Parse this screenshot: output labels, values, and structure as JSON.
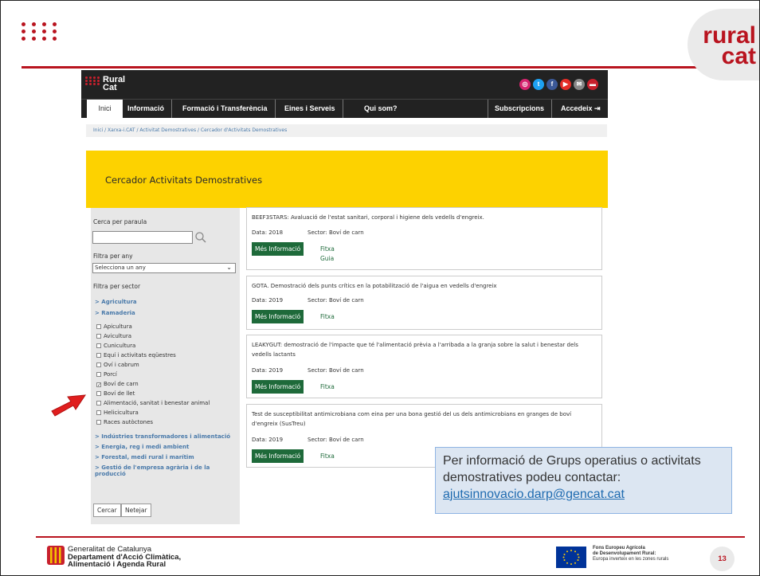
{
  "slide": {
    "logo_top_right": {
      "line1": "rural",
      "line2": "cat"
    },
    "tooltip": {
      "text": "Per informació de Grups operatius o activitats demostratives podeu contactar:",
      "email": "ajutsinnovacio.darp@gencat.cat"
    },
    "footer": {
      "gen_line1": "Generalitat de Catalunya",
      "gen_line2": "Departament d'Acció Climàtica,",
      "gen_line3": "Alimentació i Agenda Rural",
      "eu_line1": "Fons Europeu Agrícola",
      "eu_line2": "de Desenvolupament Rural:",
      "eu_line3": "Europa inverteix en les zones rurals",
      "page_number": "13"
    },
    "colors": {
      "brand_red": "#b9141f",
      "banner_yellow": "#fdd200",
      "button_green": "#1e6a3a",
      "tooltip_bg": "#dce6f2"
    },
    "arrow_icon": "red-arrow-icon"
  },
  "site": {
    "logo": {
      "line1": "Rural",
      "line2": "Cat"
    },
    "social_icons": [
      "instagram-icon",
      "twitter-icon",
      "facebook-icon",
      "youtube-icon",
      "mail-icon",
      "rss-icon"
    ],
    "nav": {
      "inici": "Inici",
      "informacio": "Informació",
      "formacio": "Formació i Transferència",
      "eines": "Eines i Serveis",
      "qui": "Qui som?",
      "subscripcions": "Subscripcions",
      "accedeix": "Accedeix"
    },
    "breadcrumb": "Inici / Xarxa-i.CAT / Activitat Demostratives / Cercador d'Activitats Demostratives",
    "banner_title": "Cercador Activitats Demostratives",
    "sidebar": {
      "search_label": "Cerca per paraula",
      "search_value": "",
      "year_label": "Filtra per any",
      "year_selected": "Selecciona un any",
      "sector_label": "Filtra per sector",
      "categories_top": [
        "> Agricultura",
        "> Ramaderia"
      ],
      "checkboxes": [
        {
          "label": "Apicultura",
          "checked": false
        },
        {
          "label": "Avicultura",
          "checked": false
        },
        {
          "label": "Cunicultura",
          "checked": false
        },
        {
          "label": "Equí i activitats eqüestres",
          "checked": false
        },
        {
          "label": "Oví i cabrum",
          "checked": false
        },
        {
          "label": "Porcí",
          "checked": false
        },
        {
          "label": "Boví de carn",
          "checked": true
        },
        {
          "label": "Boví de llet",
          "checked": false
        },
        {
          "label": "Alimentació, sanitat i benestar animal",
          "checked": false
        },
        {
          "label": "Helicicultura",
          "checked": false
        },
        {
          "label": "Races autòctones",
          "checked": false
        }
      ],
      "categories_bottom": [
        "> Indústries transformadores i alimentació",
        "> Energia, reg i medi ambient",
        "> Forestal, medi rural i marítim",
        "> Gestió de l'empresa agrària i de la",
        "producció"
      ],
      "btn_search": "Cercar",
      "btn_clear": "Netejar"
    },
    "results": [
      {
        "title": "BEEF3STARS: Avaluació de l'estat sanitari, corporal i higiene dels vedells d'engreix.",
        "title2": "",
        "data": "Data: 2018",
        "sector": "Sector: Boví de carn",
        "button": "Més Informació",
        "link1": "Fitxa",
        "link2": "Guia"
      },
      {
        "title": "GOTA. Demostració dels punts crítics en la potabilització de l'aigua en vedells d'engreix",
        "title2": "",
        "data": "Data: 2019",
        "sector": "Sector: Boví de carn",
        "button": "Més Informació",
        "link1": "Fitxa",
        "link2": ""
      },
      {
        "title": "LEAKYGUT: demostració de l'impacte que té l'alimentació prèvia a l'arribada a la granja sobre la salut i benestar dels",
        "title2": "vedells lactants",
        "data": "Data: 2019",
        "sector": "Sector: Boví de carn",
        "button": "Més Informació",
        "link1": "Fitxa",
        "link2": ""
      },
      {
        "title": "Test de susceptibilitat antimicrobiana com eina per una bona gestió del us dels antimicrobians en granges de boví",
        "title2": "d'engreix (SusTreu)",
        "data": "Data: 2019",
        "sector": "Sector: Boví de carn",
        "button": "Més Informació",
        "link1": "Fitxa",
        "link2": ""
      }
    ]
  }
}
